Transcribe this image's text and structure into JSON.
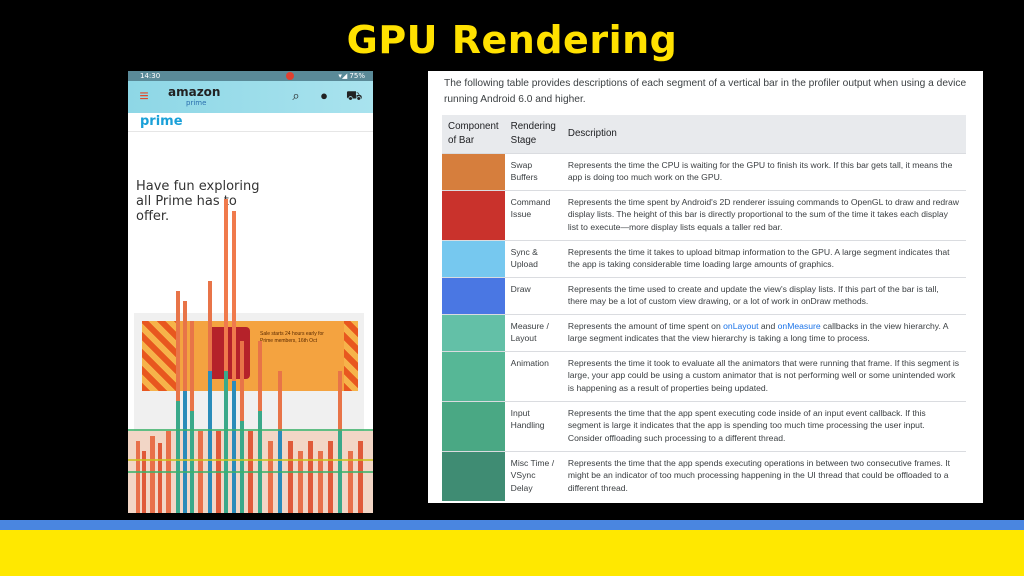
{
  "slide": {
    "title": "GPU Rendering"
  },
  "phone": {
    "status_time": "14:30",
    "status_right": "▾◢ 75%",
    "app_logo": "amazon",
    "app_logo_sub": "prime",
    "subnav_label": "prime",
    "headline": "Have fun exploring all Prime has to offer.",
    "banner_text": "Sale starts 24 hours early for Prime members, 16th Oct",
    "icons": [
      "menu-icon",
      "search-icon",
      "mic-icon",
      "cart-icon"
    ]
  },
  "doc": {
    "intro": "The following table provides descriptions of each segment of a vertical bar in the profiler output when using a device running Android 6.0 and higher.",
    "headers": [
      "Component of Bar",
      "Rendering Stage",
      "Description"
    ],
    "rows": [
      {
        "color": "#d67e3d",
        "stage": "Swap Buffers",
        "desc": "Represents the time the CPU is waiting for the GPU to finish its work. If this bar gets tall, it means the app is doing too much work on the GPU."
      },
      {
        "color": "#c9322c",
        "stage": "Command Issue",
        "desc": "Represents the time spent by Android's 2D renderer issuing commands to OpenGL to draw and redraw display lists. The height of this bar is directly proportional to the sum of the time it takes each display list to execute—more display lists equals a taller red bar."
      },
      {
        "color": "#76c8ef",
        "stage": "Sync & Upload",
        "desc": "Represents the time it takes to upload bitmap information to the GPU. A large segment indicates that the app is taking considerable time loading large amounts of graphics."
      },
      {
        "color": "#4a77e3",
        "stage": "Draw",
        "desc": "Represents the time used to create and update the view's display lists. If this part of the bar is tall, there may be a lot of custom view drawing, or a lot of work in onDraw methods."
      },
      {
        "color": "#63c0a7",
        "stage": "Measure / Layout",
        "desc_pre": "Represents the amount of time spent on ",
        "link1": "onLayout",
        "desc_mid": " and ",
        "link2": "onMeasure",
        "desc_post": " callbacks in the view hierarchy. A large segment indicates that the view hierarchy is taking a long time to process."
      },
      {
        "color": "#56b796",
        "stage": "Animation",
        "desc": "Represents the time it took to evaluate all the animators that were running that frame. If this segment is large, your app could be using a custom animator that is not performing well or some unintended work is happening as a result of properties being updated."
      },
      {
        "color": "#4aa884",
        "stage": "Input Handling",
        "desc": "Represents the time that the app spent executing code inside of an input event callback. If this segment is large it indicates that the app is spending too much time processing the user input. Consider offloading such processing to a different thread."
      },
      {
        "color": "#3f8c73",
        "stage": "Misc Time / VSync Delay",
        "desc": "Represents the time that the app spends executing operations in between two consecutive frames. It might be an indicator of too much processing happening in the UI thread that could be offloaded to a different thread."
      }
    ]
  },
  "colors": {
    "title": "#ffe100",
    "band_blue": "#4a86e0",
    "band_yellow": "#ffe800",
    "background": "#000000"
  }
}
